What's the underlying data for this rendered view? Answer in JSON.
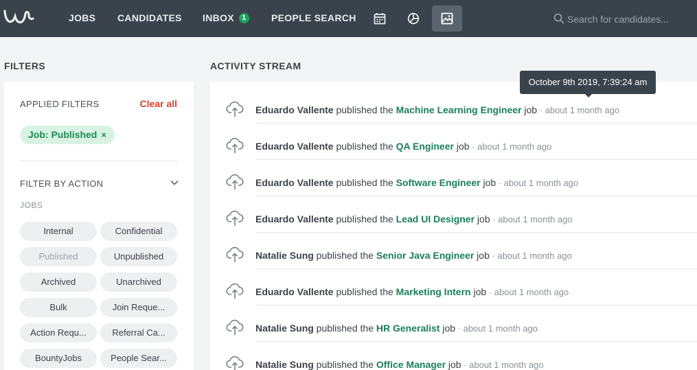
{
  "nav": {
    "items": [
      {
        "label": "JOBS"
      },
      {
        "label": "CANDIDATES"
      },
      {
        "label": "INBOX",
        "badge": "1"
      },
      {
        "label": "PEOPLE SEARCH"
      }
    ],
    "icons": [
      "calendar-icon",
      "pie-chart-icon",
      "image-icon"
    ],
    "search_placeholder": "Search for candidates..."
  },
  "filters": {
    "title": "FILTERS",
    "applied_label": "APPLIED FILTERS",
    "clear_all": "Clear all",
    "chip": {
      "label": "Job: Published",
      "remove": "×"
    },
    "filter_by_action": "FILTER BY ACTION",
    "jobs_label": "JOBS",
    "pills": [
      "Internal",
      "Confidential",
      "Published",
      "Unpublished",
      "Archived",
      "Unarchived",
      "Bulk",
      "Join Reque...",
      "Action Requ...",
      "Referral Ca...",
      "BountyJobs",
      "People Sear..."
    ]
  },
  "stream": {
    "title": "ACTIVITY STREAM",
    "tooltip": "October 9th 2019, 7:39:24 am",
    "rows": [
      {
        "user": "Eduardo Vallente",
        "verb": " published the ",
        "job": "Machine Learning Engineer",
        "suffix": " job",
        "time": " · about 1 month ago"
      },
      {
        "user": "Eduardo Vallente",
        "verb": " published the ",
        "job": "QA Engineer",
        "suffix": " job",
        "time": " · about 1 month ago"
      },
      {
        "user": "Eduardo Vallente",
        "verb": " published the ",
        "job": "Software Engineer",
        "suffix": " job",
        "time": " · about 1 month ago"
      },
      {
        "user": "Eduardo Vallente",
        "verb": " published the ",
        "job": "Lead UI Designer",
        "suffix": " job",
        "time": " · about 1 month ago"
      },
      {
        "user": "Natalie Sung",
        "verb": " published the ",
        "job": "Senior Java Engineer",
        "suffix": " job",
        "time": " · about 1 month ago"
      },
      {
        "user": "Eduardo Vallente",
        "verb": " published the ",
        "job": "Marketing Intern",
        "suffix": " job",
        "time": " · about 1 month ago"
      },
      {
        "user": "Natalie Sung",
        "verb": " published the ",
        "job": "HR Generalist",
        "suffix": " job",
        "time": " · about 1 month ago"
      },
      {
        "user": "Natalie Sung",
        "verb": " published the ",
        "job": "Office Manager",
        "suffix": " job",
        "time": " · about 1 month ago"
      }
    ]
  },
  "colors": {
    "nav_bg": "#3a434b",
    "accent_green": "#1a7f5a",
    "clear_red": "#d8412f",
    "chip_bg": "#d9f3e3"
  }
}
